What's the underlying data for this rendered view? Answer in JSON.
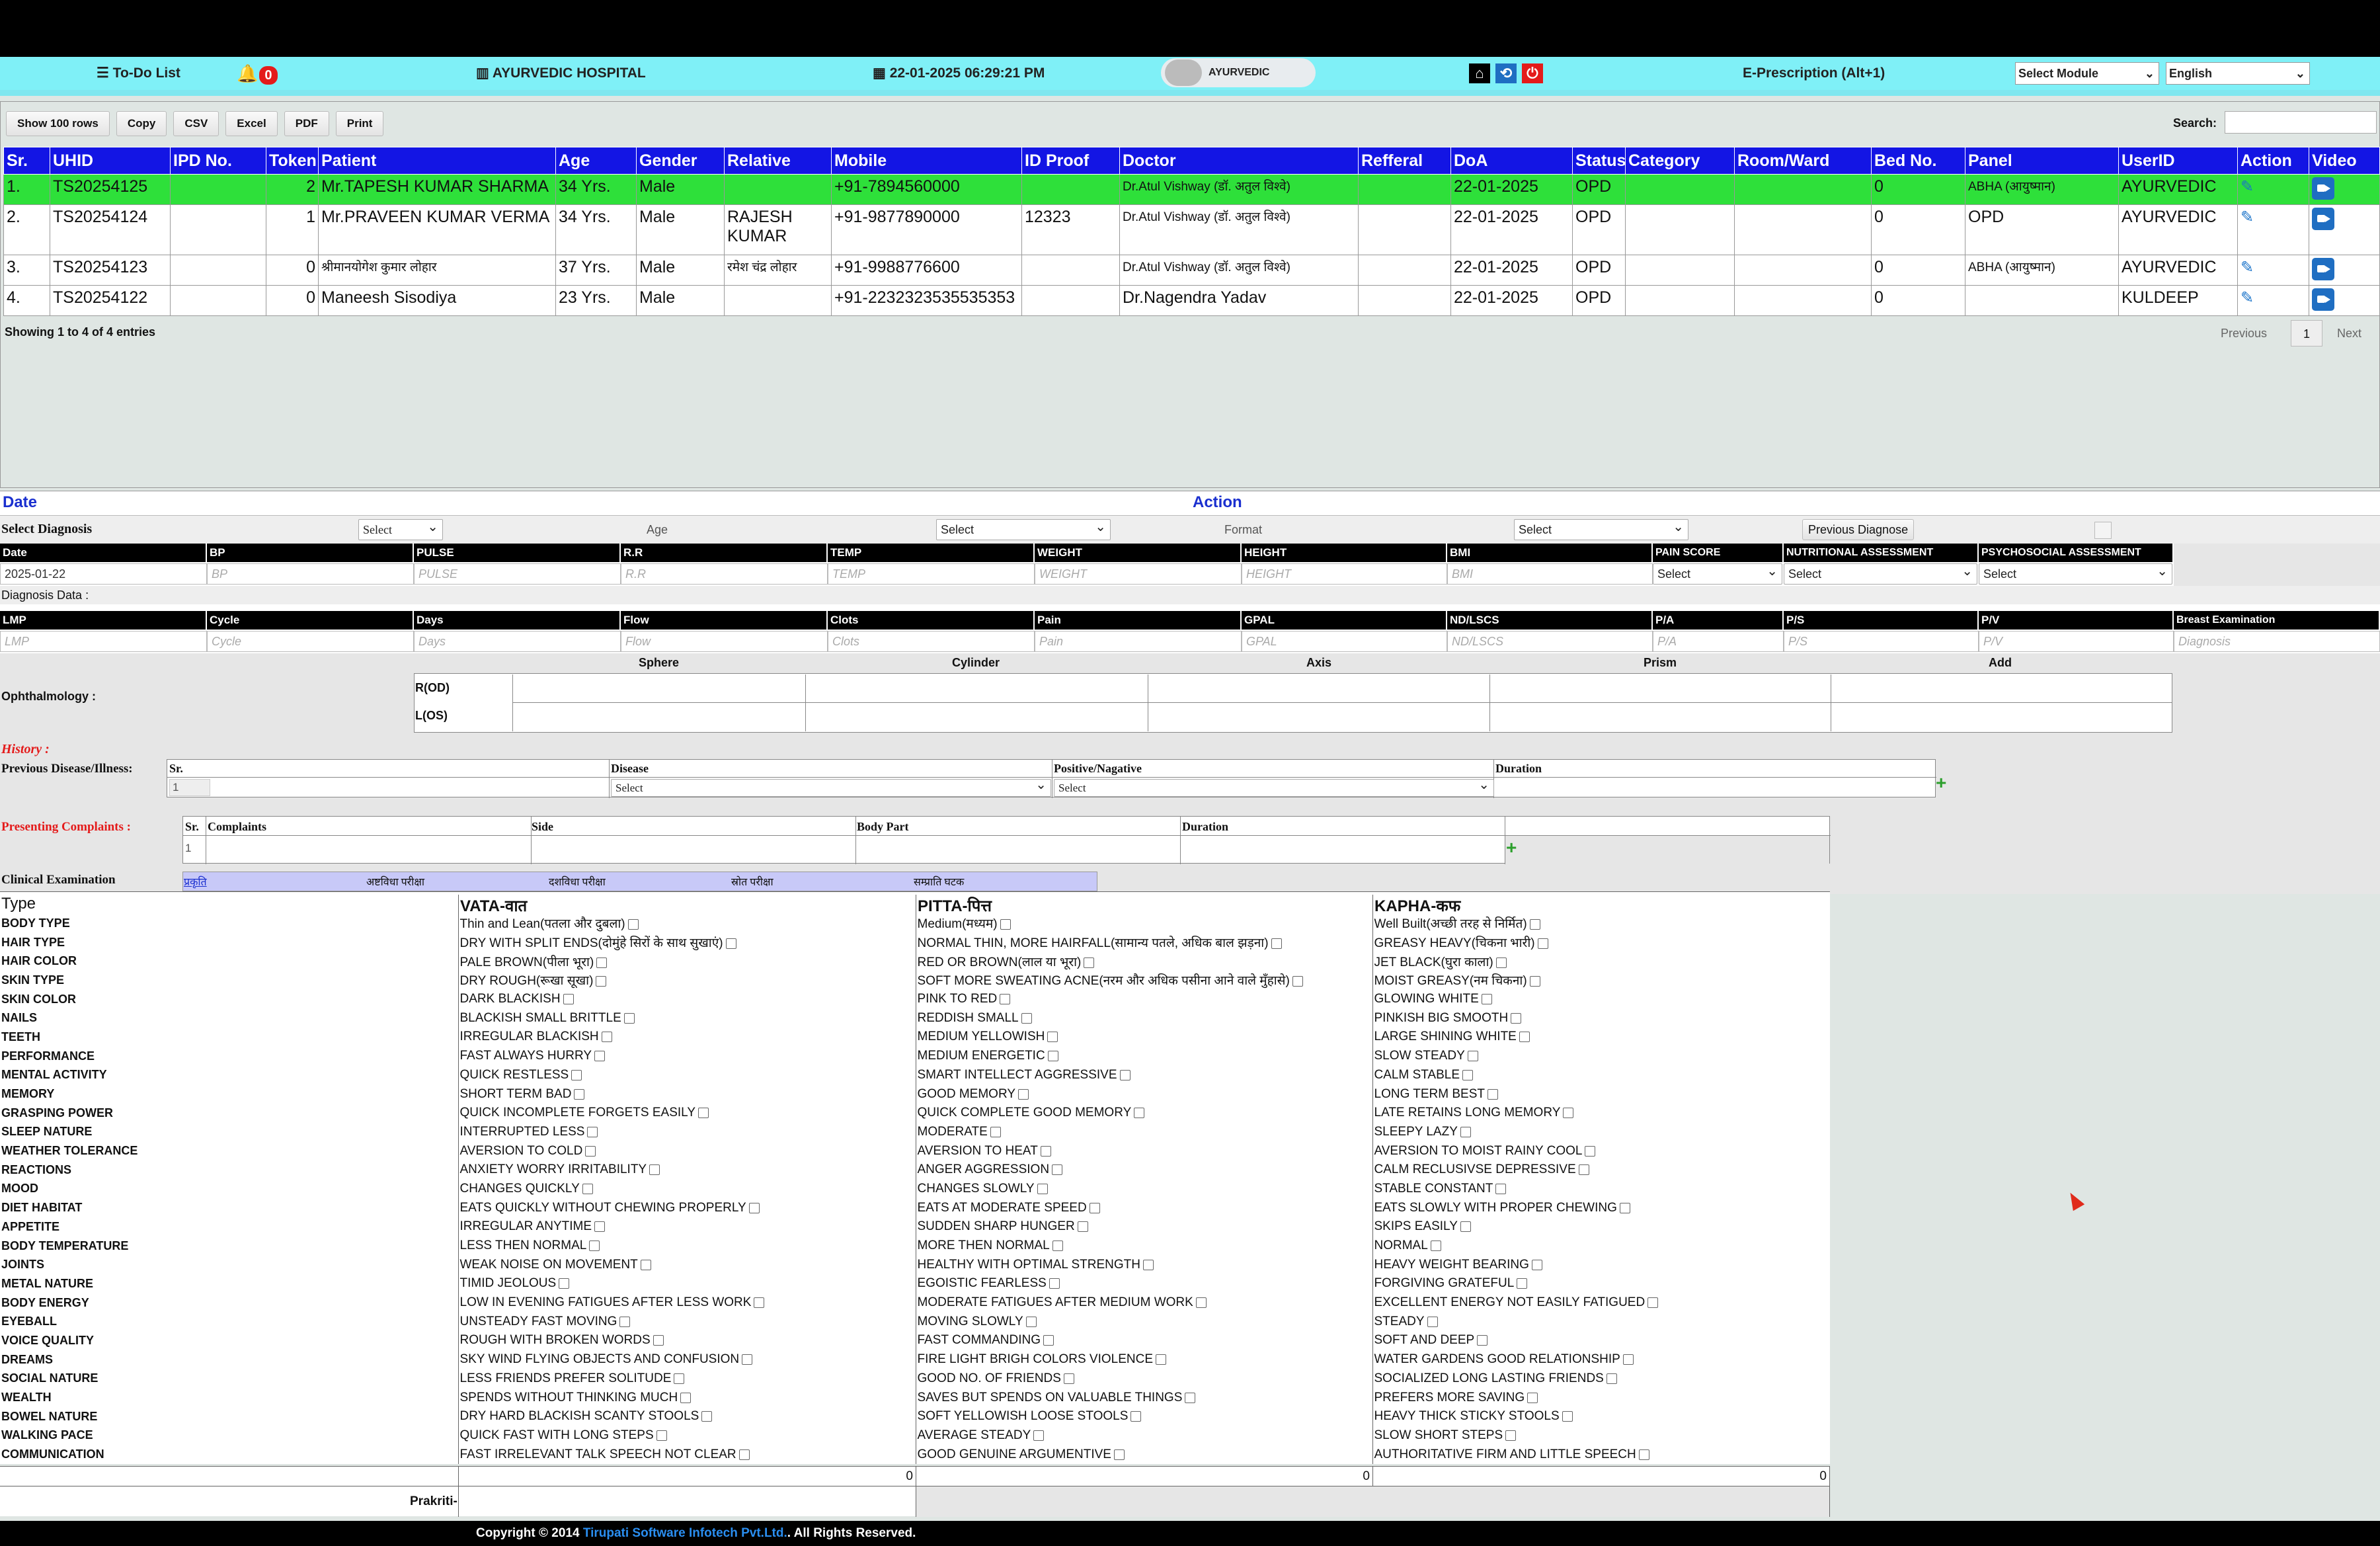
{
  "topbar": {
    "todo": "To-Do List",
    "notif_count": "0",
    "hospital": "AYURVEDIC HOSPITAL",
    "datetime": "22-01-2025 06:29:21 PM",
    "user": "AYURVEDIC",
    "eprescription": "E-Prescription (Alt+1)",
    "module_select": "Select Module",
    "language_select": "English"
  },
  "toolbar": {
    "show_rows": "Show 100 rows",
    "copy": "Copy",
    "csv": "CSV",
    "excel": "Excel",
    "pdf": "PDF",
    "print": "Print",
    "search_label": "Search:"
  },
  "patients": {
    "headers": [
      "Sr.",
      "UHID",
      "IPD No.",
      "Token",
      "Patient",
      "Age",
      "Gender",
      "Relative",
      "Mobile",
      "ID Proof",
      "Doctor",
      "Refferal",
      "DoA",
      "Status",
      "Category",
      "Room/Ward",
      "Bed No.",
      "Panel",
      "UserID",
      "Action",
      "Video"
    ],
    "rows": [
      [
        "1.",
        "TS20254125",
        "",
        "2",
        "Mr.TAPESH KUMAR SHARMA",
        "34 Yrs.",
        "Male",
        "",
        "+91-7894560000",
        "",
        "Dr.Atul Vishway (डॉ. अतुल विश्वे)",
        "",
        "22-01-2025",
        "OPD",
        "",
        "",
        "0",
        "ABHA (आयुष्मान)",
        "AYURVEDIC"
      ],
      [
        "2.",
        "TS20254124",
        "",
        "1",
        "Mr.PRAVEEN KUMAR VERMA",
        "34 Yrs.",
        "Male",
        "RAJESH KUMAR",
        "+91-9877890000",
        "12323",
        "Dr.Atul Vishway (डॉ. अतुल विश्वे)",
        "",
        "22-01-2025",
        "OPD",
        "",
        "",
        "0",
        "OPD",
        "AYURVEDIC"
      ],
      [
        "3.",
        "TS20254123",
        "",
        "0",
        "श्रीमानयोगेश कुमार लोहार",
        "37 Yrs.",
        "Male",
        "रमेश चंद्र लोहार",
        "+91-9988776600",
        "",
        "Dr.Atul Vishway (डॉ. अतुल विश्वे)",
        "",
        "22-01-2025",
        "OPD",
        "",
        "",
        "0",
        "ABHA (आयुष्मान)",
        "AYURVEDIC"
      ],
      [
        "4.",
        "TS20254122",
        "",
        "0",
        "Maneesh Sisodiya",
        "23 Yrs.",
        "Male",
        "",
        "+91-2232323535535353",
        "",
        "Dr.Nagendra Yadav",
        "",
        "22-01-2025",
        "OPD",
        "",
        "",
        "0",
        "",
        "KULDEEP"
      ]
    ],
    "info": "Showing 1 to 4 of 4 entries",
    "prev": "Previous",
    "page": "1",
    "next": "Next"
  },
  "diag": {
    "date_label": "Date",
    "action_label": "Action",
    "select_diagnosis": "Select Diagnosis",
    "select": "Select",
    "age": "Age",
    "format": "Format",
    "prev_diag": "Previous Diagnose"
  },
  "vitals": {
    "headers": [
      "Date",
      "BP",
      "PULSE",
      "R.R",
      "TEMP",
      "WEIGHT",
      "HEIGHT",
      "BMI",
      "PAIN SCORE",
      "NUTRITIONAL ASSESSMENT",
      "PSYCHOSOCIAL ASSESSMENT"
    ],
    "date_value": "2025-01-22",
    "placeholders": [
      "BP",
      "PULSE",
      "R.R",
      "TEMP",
      "WEIGHT",
      "HEIGHT",
      "BMI"
    ],
    "select": "Select"
  },
  "diagnosis_data_label": "Diagnosis Data :",
  "gyn": {
    "headers": [
      "LMP",
      "Cycle",
      "Days",
      "Flow",
      "Clots",
      "Pain",
      "GPAL",
      "ND/LSCS",
      "P/A",
      "P/S",
      "P/V",
      "Breast Examination"
    ],
    "placeholders": [
      "LMP",
      "Cycle",
      "Days",
      "Flow",
      "Clots",
      "Pain",
      "GPAL",
      "ND/LSCS",
      "P/A",
      "P/S",
      "P/V",
      "Diagnosis"
    ]
  },
  "ophth": {
    "label": "Ophthalmology :",
    "cols": [
      "Sphere",
      "Cylinder",
      "Axis",
      "Prism",
      "Add"
    ],
    "rows": [
      "R(OD)",
      "L(OS)"
    ]
  },
  "history": {
    "label": "History :",
    "prev_disease": "Previous Disease/Illness:",
    "cols": [
      "Sr.",
      "Disease",
      "Positive/Nagative",
      "Duration"
    ],
    "sr": "1",
    "select": "Select"
  },
  "complaints": {
    "label": "Presenting Complaints :",
    "cols": [
      "Sr.",
      "Complaints",
      "Side",
      "Body Part",
      "Duration"
    ],
    "sr": "1"
  },
  "clinical": {
    "label": "Clinical Examination",
    "tabs": [
      "प्रकृति",
      "अष्टविधा परीक्षा",
      "दशविधा परीक्षा",
      "स्रोत परीक्षा",
      "सम्प्राति घटक"
    ]
  },
  "prakriti": {
    "headers": [
      "Type",
      "VATA-वात",
      "PITTA-पित्त",
      "KAPHA-कफ"
    ],
    "rows": [
      [
        "BODY TYPE",
        "Thin and Lean(पतला और दुबला)",
        "Medium(मध्यम)",
        "Well Built(अच्छी तरह से निर्मित)"
      ],
      [
        "HAIR TYPE",
        "DRY WITH SPLIT ENDS(दोमुंहे सिरों के साथ सुखाएं)",
        "NORMAL THIN, MORE HAIRFALL(सामान्य पतले, अधिक बाल झड़ना)",
        "GREASY HEAVY(चिकना भारी)"
      ],
      [
        "HAIR COLOR",
        "PALE BROWN(पीला भूरा)",
        "RED OR BROWN(लाल या भूरा)",
        "JET BLACK(घुरा काला)"
      ],
      [
        "SKIN TYPE",
        "DRY ROUGH(रूखा सूखा)",
        "SOFT MORE SWEATING ACNE(नरम और अधिक पसीना आने वाले मुँहासे)",
        "MOIST GREASY(नम चिकना)"
      ],
      [
        "SKIN COLOR",
        "DARK BLACKISH",
        "PINK TO RED",
        "GLOWING WHITE"
      ],
      [
        "NAILS",
        "BLACKISH SMALL BRITTLE",
        "REDDISH SMALL",
        "PINKISH BIG SMOOTH"
      ],
      [
        "TEETH",
        "IRREGULAR BLACKISH",
        "MEDIUM YELLOWISH",
        "LARGE SHINING WHITE"
      ],
      [
        "PERFORMANCE",
        "FAST ALWAYS HURRY",
        "MEDIUM ENERGETIC",
        "SLOW STEADY"
      ],
      [
        "MENTAL ACTIVITY",
        "QUICK RESTLESS",
        "SMART INTELLECT AGGRESSIVE",
        "CALM STABLE"
      ],
      [
        "MEMORY",
        "SHORT TERM BAD",
        "GOOD MEMORY",
        "LONG TERM BEST"
      ],
      [
        "GRASPING POWER",
        "QUICK INCOMPLETE FORGETS EASILY",
        "QUICK COMPLETE GOOD MEMORY",
        "LATE RETAINS LONG MEMORY"
      ],
      [
        "SLEEP NATURE",
        "INTERRUPTED LESS",
        "MODERATE",
        "SLEEPY LAZY"
      ],
      [
        "WEATHER TOLERANCE",
        "AVERSION TO COLD",
        "AVERSION TO HEAT",
        "AVERSION TO MOIST RAINY COOL"
      ],
      [
        "REACTIONS",
        "ANXIETY WORRY IRRITABILITY",
        "ANGER AGGRESSION",
        "CALM RECLUSIVSE DEPRESSIVE"
      ],
      [
        "MOOD",
        "CHANGES QUICKLY",
        "CHANGES SLOWLY",
        "STABLE CONSTANT"
      ],
      [
        "DIET HABITAT",
        "EATS QUICKLY WITHOUT CHEWING PROPERLY",
        "EATS AT MODERATE SPEED",
        "EATS SLOWLY WITH PROPER CHEWING"
      ],
      [
        "APPETITE",
        "IRREGULAR ANYTIME",
        "SUDDEN SHARP HUNGER",
        "SKIPS EASILY"
      ],
      [
        "BODY TEMPERATURE",
        "LESS THEN NORMAL",
        "MORE THEN NORMAL",
        "NORMAL"
      ],
      [
        "JOINTS",
        "WEAK NOISE ON MOVEMENT",
        "HEALTHY WITH OPTIMAL STRENGTH",
        "HEAVY WEIGHT BEARING"
      ],
      [
        "METAL NATURE",
        "TIMID JEOLOUS",
        "EGOISTIC FEARLESS",
        "FORGIVING GRATEFUL"
      ],
      [
        "BODY ENERGY",
        "LOW IN EVENING FATIGUES AFTER LESS WORK",
        "MODERATE FATIGUES AFTER MEDIUM WORK",
        "EXCELLENT ENERGY NOT EASILY FATIGUED"
      ],
      [
        "EYEBALL",
        "UNSTEADY FAST MOVING",
        "MOVING SLOWLY",
        "STEADY"
      ],
      [
        "VOICE QUALITY",
        "ROUGH WITH BROKEN WORDS",
        "FAST COMMANDING",
        "SOFT AND DEEP"
      ],
      [
        "DREAMS",
        "SKY WIND FLYING OBJECTS AND CONFUSION",
        "FIRE LIGHT BRIGH COLORS VIOLENCE",
        "WATER GARDENS GOOD RELATIONSHIP"
      ],
      [
        "SOCIAL NATURE",
        "LESS FRIENDS PREFER SOLITUDE",
        "GOOD NO. OF FRIENDS",
        "SOCIALIZED LONG LASTING FRIENDS"
      ],
      [
        "WEALTH",
        "SPENDS WITHOUT THINKING MUCH",
        "SAVES BUT SPENDS ON VALUABLE THINGS",
        "PREFERS MORE SAVING"
      ],
      [
        "BOWEL NATURE",
        "DRY HARD BLACKISH SCANTY STOOLS",
        "SOFT YELLOWISH LOOSE STOOLS",
        "HEAVY THICK STICKY STOOLS"
      ],
      [
        "WALKING PACE",
        "QUICK FAST WITH LONG STEPS",
        "AVERAGE STEADY",
        "SLOW SHORT STEPS"
      ],
      [
        "COMMUNICATION",
        "FAST IRRELEVANT TALK SPEECH NOT CLEAR",
        "GOOD GENUINE ARGUMENTIVE",
        "AUTHORITATIVE FIRM AND LITTLE SPEECH"
      ]
    ],
    "totals": [
      "0",
      "0",
      "0"
    ],
    "prakriti_label": "Prakriti-"
  },
  "footer": {
    "pre": "Copyright © 2014 ",
    "company": "Tirupati Software Infotech Pvt.Ltd.",
    "post": ". All Rights Reserved."
  }
}
